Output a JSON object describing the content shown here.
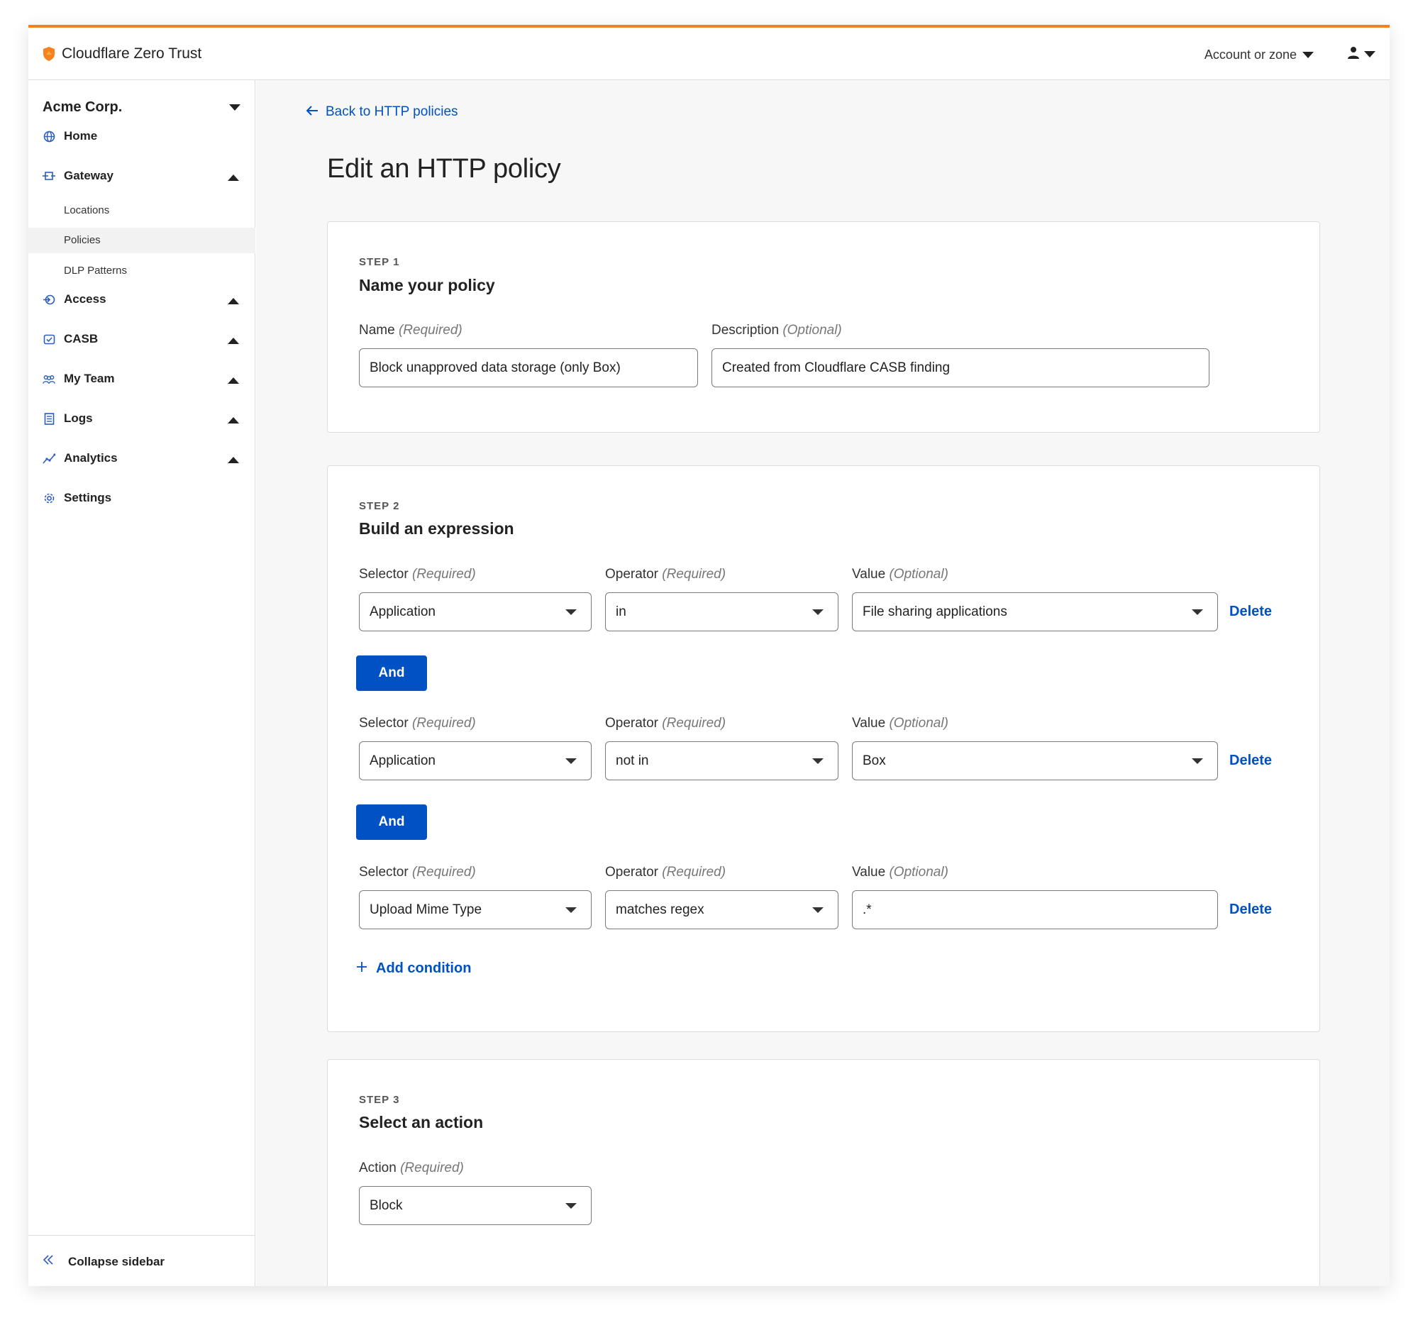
{
  "brand": {
    "name": "Cloudflare Zero Trust"
  },
  "header": {
    "account_selector": "Account or zone"
  },
  "sidebar": {
    "org": "Acme Corp.",
    "items": [
      {
        "label": "Home",
        "icon": "globe-icon"
      },
      {
        "label": "Gateway",
        "icon": "gateway-icon",
        "expanded": true,
        "children": [
          "Locations",
          "Policies",
          "DLP Patterns"
        ],
        "active_child": "Policies"
      },
      {
        "label": "Access",
        "icon": "access-icon"
      },
      {
        "label": "CASB",
        "icon": "casb-icon"
      },
      {
        "label": "My Team",
        "icon": "team-icon"
      },
      {
        "label": "Logs",
        "icon": "logs-icon"
      },
      {
        "label": "Analytics",
        "icon": "analytics-icon"
      },
      {
        "label": "Settings",
        "icon": "gear-icon"
      }
    ],
    "collapse": "Collapse sidebar"
  },
  "main": {
    "back_link": "Back to HTTP policies",
    "title": "Edit an HTTP policy",
    "step1": {
      "step": "STEP 1",
      "title": "Name your policy",
      "name_label": "Name",
      "name_hint": "(Required)",
      "name_value": "Block unapproved data storage (only Box)",
      "desc_label": "Description",
      "desc_hint": "(Optional)",
      "desc_value": "Created from Cloudflare CASB finding"
    },
    "step2": {
      "step": "STEP 2",
      "title": "Build an expression",
      "selector_label": "Selector",
      "operator_label": "Operator",
      "value_label": "Value",
      "required": "(Required)",
      "optional": "(Optional)",
      "conditions": [
        {
          "selector": "Application",
          "operator": "in",
          "value": "File sharing applications"
        },
        {
          "selector": "Application",
          "operator": "not in",
          "value": "Box"
        },
        {
          "selector": "Upload Mime Type",
          "operator": "matches regex",
          "value": ".*"
        }
      ],
      "and_label": "And",
      "delete_label": "Delete",
      "add_condition": "Add condition"
    },
    "step3": {
      "step": "STEP 3",
      "title": "Select an action",
      "action_label": "Action",
      "action_hint": "(Required)",
      "action_value": "Block"
    }
  },
  "colors": {
    "accent": "#0051c3",
    "brand_orange": "#f6821f"
  }
}
